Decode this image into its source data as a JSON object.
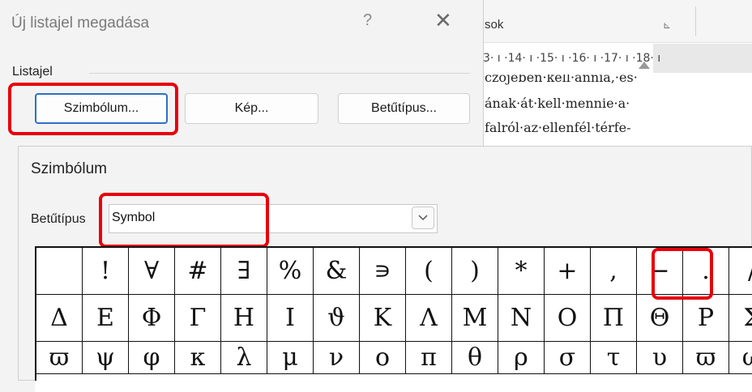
{
  "word": {
    "ribbon_group_label": "sok",
    "ruler_text": "3· ı ·14· ı ·15· ı ·16· ı ·17· ı ·18· ı",
    "doc_lines": [
      "czojeben·kell·annia,·es·",
      "ának·át·kell·mennie·a·",
      "falról·az·ellenfél·térfe-"
    ]
  },
  "bullet_dialog": {
    "title": "Új listajel megadása",
    "help": "?",
    "close": "✕",
    "group_label": "Listajel",
    "buttons": {
      "symbol": "Szimbólum...",
      "picture": "Kép...",
      "font": "Betűtípus..."
    }
  },
  "symbol_dialog": {
    "title": "Szimbólum",
    "font_label": "Betűtípus",
    "font_value": "Symbol",
    "rows": [
      [
        "",
        "!",
        "∀",
        "#",
        "∃",
        "%",
        "&",
        "∍",
        "(",
        ")",
        "*",
        "+",
        ",",
        "−",
        ".",
        "/"
      ],
      [
        "Δ",
        "Ε",
        "Φ",
        "Γ",
        "Η",
        "Ι",
        "ϑ",
        "Κ",
        "Λ",
        "Μ",
        "Ν",
        "Ο",
        "Π",
        "Θ",
        "Ρ",
        "Σ"
      ],
      [
        "ϖ",
        "ψ",
        "φ",
        "κ",
        "λ",
        "μ",
        "ν",
        "ο",
        "π",
        "θ",
        "ρ",
        "σ",
        "τ",
        "υ",
        "ϖ",
        "ω"
      ]
    ]
  },
  "colors": {
    "highlight": "#e8000b",
    "focus_border": "#2f6fc4"
  },
  "icons": {
    "help": "question-icon",
    "close": "close-icon",
    "dropdown": "chevron-down-icon",
    "launcher": "dialog-launcher-icon"
  }
}
